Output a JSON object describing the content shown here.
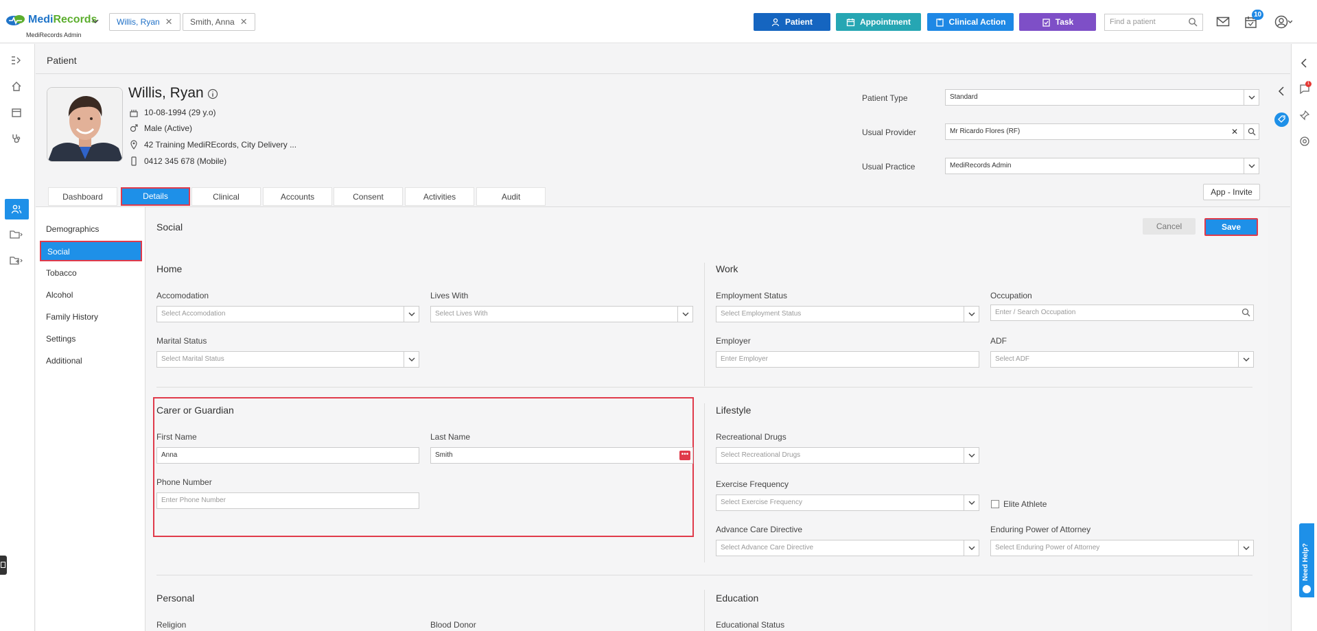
{
  "brand": {
    "name_part1": "Medi",
    "name_part2": "Records",
    "subtitle": "MediRecords Admin"
  },
  "open_patient_tabs": [
    {
      "label": "Willis, Ryan",
      "active": true
    },
    {
      "label": "Smith, Anna",
      "active": false
    }
  ],
  "top_actions": [
    {
      "label": "Patient",
      "color": "#1565c0",
      "icon": "user-plus-icon"
    },
    {
      "label": "Appointment",
      "color": "#26a6b3",
      "icon": "calendar-icon"
    },
    {
      "label": "Clinical Action",
      "color": "#1e88e5",
      "icon": "clipboard-icon"
    },
    {
      "label": "Task",
      "color": "#7e4fc7",
      "icon": "task-icon"
    }
  ],
  "search": {
    "placeholder": "Find a patient"
  },
  "tasks_badge": "10",
  "notifications_badge": "1",
  "page_title": "Patient",
  "patient": {
    "name": "Willis, Ryan",
    "dob": "10-08-1994 (29 y.o)",
    "gender": "Male (Active)",
    "address": "42 Training MediREcords, City Delivery ...",
    "phone": "0412 345 678 (Mobile)"
  },
  "patient_fields": {
    "patient_type_label": "Patient Type",
    "patient_type_value": "Standard",
    "usual_provider_label": "Usual Provider",
    "usual_provider_value": "Mr Ricardo Flores (RF)",
    "usual_practice_label": "Usual Practice",
    "usual_practice_value": "MediRecords Admin"
  },
  "app_invite_label": "App - Invite",
  "tabs": [
    "Dashboard",
    "Details",
    "Clinical",
    "Accounts",
    "Consent",
    "Activities",
    "Audit"
  ],
  "active_tab": "Details",
  "submenu": [
    "Demographics",
    "Social",
    "Tobacco",
    "Alcohol",
    "Family History",
    "Settings",
    "Additional"
  ],
  "active_submenu": "Social",
  "section_title": "Social",
  "buttons": {
    "cancel": "Cancel",
    "save": "Save"
  },
  "home": {
    "title": "Home",
    "accomodation_label": "Accomodation",
    "accomodation_placeholder": "Select Accomodation",
    "lives_with_label": "Lives With",
    "lives_with_placeholder": "Select Lives With",
    "marital_label": "Marital Status",
    "marital_placeholder": "Select Marital Status"
  },
  "work": {
    "title": "Work",
    "employment_label": "Employment Status",
    "employment_placeholder": "Select Employment Status",
    "occupation_label": "Occupation",
    "occupation_placeholder": "Enter / Search Occupation",
    "employer_label": "Employer",
    "employer_placeholder": "Enter Employer",
    "adf_label": "ADF",
    "adf_placeholder": "Select ADF"
  },
  "carer": {
    "title": "Carer or Guardian",
    "first_name_label": "First Name",
    "first_name_value": "Anna",
    "last_name_label": "Last Name",
    "last_name_value": "Smith",
    "phone_label": "Phone Number",
    "phone_placeholder": "Enter Phone Number"
  },
  "lifestyle": {
    "title": "Lifestyle",
    "drugs_label": "Recreational Drugs",
    "drugs_placeholder": "Select Recreational Drugs",
    "exercise_label": "Exercise Frequency",
    "exercise_placeholder": "Select Exercise Frequency",
    "elite_athlete_label": "Elite Athlete",
    "elite_athlete_checked": false,
    "acd_label": "Advance Care Directive",
    "acd_placeholder": "Select Advance Care Directive",
    "epa_label": "Enduring Power of Attorney",
    "epa_placeholder": "Select Enduring Power of Attorney"
  },
  "personal": {
    "title": "Personal",
    "religion_label": "Religion",
    "blood_donor_label": "Blood Donor"
  },
  "education": {
    "title": "Education",
    "status_label": "Educational Status"
  },
  "need_help": "Need Help?"
}
